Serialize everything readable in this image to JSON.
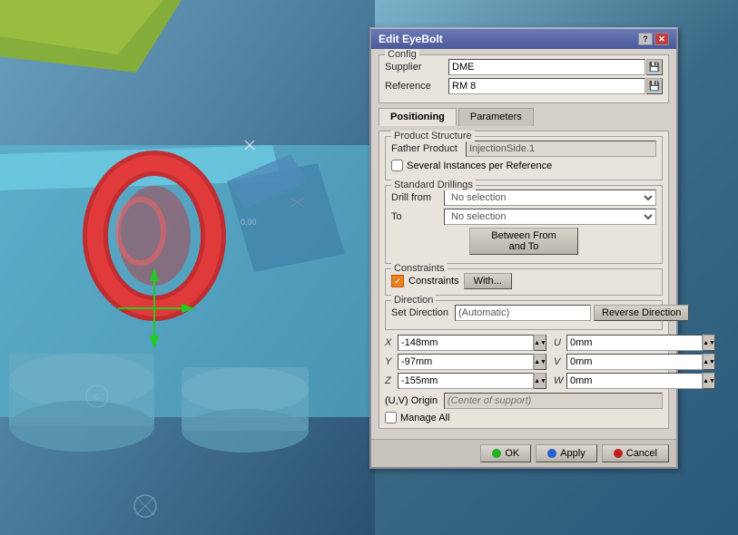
{
  "dialog": {
    "title": "Edit EyeBolt",
    "help_btn": "?",
    "close_btn": "✕"
  },
  "config": {
    "section_label": "Config",
    "supplier_label": "Supplier",
    "supplier_value": "DME",
    "reference_label": "Reference",
    "reference_value": "RM 8"
  },
  "tabs": [
    {
      "id": "positioning",
      "label": "Positioning",
      "active": true
    },
    {
      "id": "parameters",
      "label": "Parameters",
      "active": false
    }
  ],
  "product_structure": {
    "section_label": "Product Structure",
    "father_product_label": "Father Product",
    "father_product_value": "InjectionSide.1",
    "several_instances_label": "Several Instances per Reference"
  },
  "standard_drillings": {
    "section_label": "Standard Drillings",
    "drill_from_label": "Drill from",
    "drill_from_value": "No selection",
    "to_label": "To",
    "to_value": "No selection",
    "between_btn_label": "Between From and To"
  },
  "constraints": {
    "section_label": "Constraints",
    "constraints_label": "Constraints",
    "with_btn_label": "With..."
  },
  "direction": {
    "section_label": "Direction",
    "set_direction_label": "Set Direction",
    "set_direction_value": "(Automatic)",
    "reverse_btn_label": "Reverse Direction"
  },
  "coordinates": {
    "x_label": "X",
    "x_value": "-148mm",
    "y_label": "Y",
    "y_value": "-97mm",
    "z_label": "Z",
    "z_value": "-155mm",
    "u_label": "U",
    "u_value": "0mm",
    "v_label": "V",
    "v_value": "0mm",
    "w_label": "W",
    "w_value": "0mm"
  },
  "origin": {
    "label": "(U,V) Origin",
    "placeholder": "(Center of support)"
  },
  "manage_all": {
    "label": "Manage All"
  },
  "footer": {
    "ok_label": "OK",
    "apply_label": "Apply",
    "cancel_label": "Cancel"
  }
}
